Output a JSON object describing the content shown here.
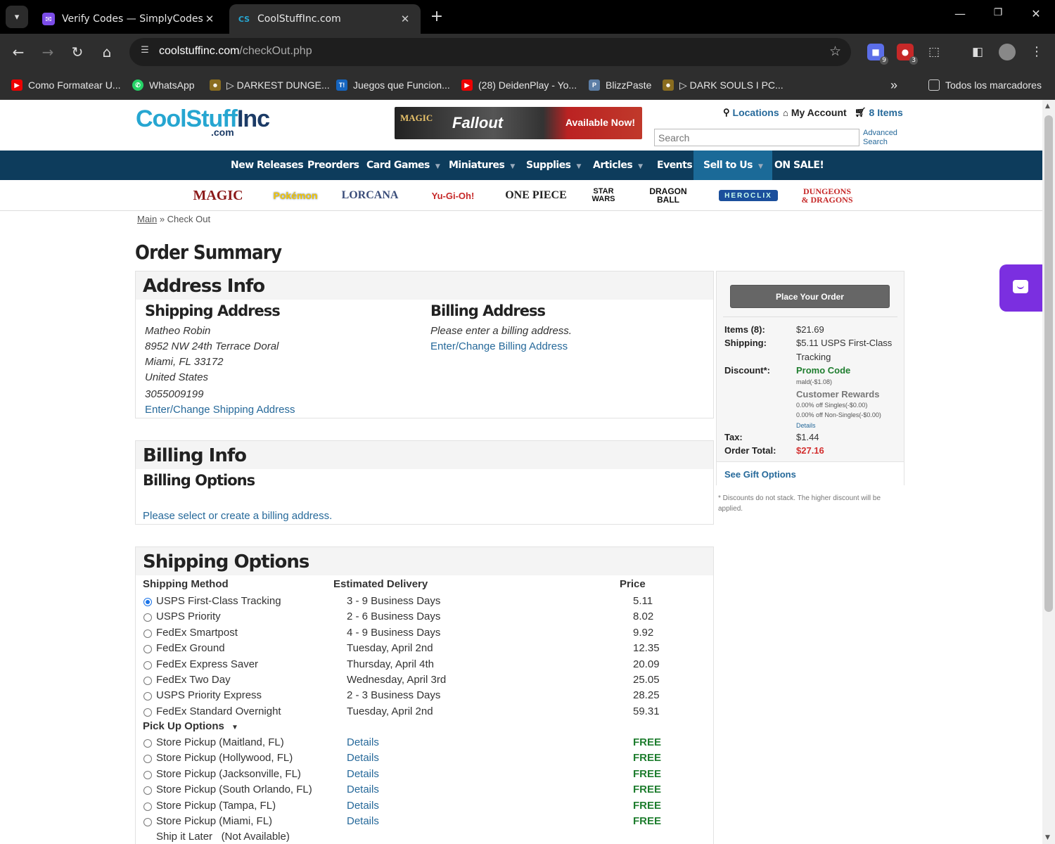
{
  "browser": {
    "tabs": [
      {
        "title": "Verify Codes — SimplyCodes",
        "active": false
      },
      {
        "title": "CoolStuffInc.com",
        "active": true
      }
    ],
    "url_host": "coolstuffinc.com",
    "url_path": "/checkOut.php",
    "extension_badges": [
      "9",
      "3"
    ],
    "bookmarks": [
      "Como Formatear U...",
      "WhatsApp",
      "▷ DARKEST DUNGE...",
      "Juegos que Funcion...",
      "(28) DeidenPlay - Yo...",
      "BlizzPaste",
      "▷ DARK SOULS I PC..."
    ],
    "bookmarks_overflow": "»",
    "all_bookmarks": "Todos los marcadores"
  },
  "site": {
    "logo_main": "CoolStuff",
    "logo_inc": "Inc",
    "logo_sub": ".com",
    "banner": {
      "magic": "MAGIC",
      "fallout": "Fallout",
      "cta": "Available Now!"
    },
    "top_links": {
      "locations": "Locations",
      "account": "My Account",
      "cart": "8 Items"
    },
    "search_placeholder": "Search",
    "advanced_search": [
      "Advanced",
      "Search"
    ],
    "nav": [
      "New Releases",
      "Preorders",
      "Card Games",
      "Miniatures",
      "Supplies",
      "Articles",
      "Events",
      "Sell to Us",
      "ON SALE!"
    ],
    "brands": [
      "MAGIC",
      "Pokémon",
      "LORCANA",
      "Yu-Gi-Oh!",
      "ONE PIECE",
      "STAR WARS",
      "DRAGON BALL",
      "HEROCLIX",
      "DUNGEONS & DRAGONS"
    ],
    "breadcrumb": {
      "main": "Main",
      "sep": "»",
      "current": "Check Out"
    }
  },
  "checkout": {
    "title": "Order Summary",
    "address": {
      "heading": "Address Info",
      "shipping_heading": "Shipping Address",
      "shipping_lines": [
        "Matheo Robin",
        "8952 NW 24th Terrace Doral",
        "Miami, FL 33172",
        "United States",
        "3055009199"
      ],
      "shipping_link": "Enter/Change Shipping Address",
      "billing_heading": "Billing Address",
      "billing_note": "Please enter a billing address.",
      "billing_link": "Enter/Change Billing Address"
    },
    "billing": {
      "heading": "Billing Info",
      "options_heading": "Billing Options",
      "prompt": "Please select or create a billing address."
    },
    "shipping": {
      "heading": "Shipping Options",
      "col_method": "Shipping Method",
      "col_delivery": "Estimated Delivery",
      "col_price": "Price",
      "methods": [
        {
          "name": "USPS First-Class Tracking",
          "delivery": "3 - 9 Business Days",
          "price": "5.11",
          "selected": true
        },
        {
          "name": "USPS Priority",
          "delivery": "2 - 6 Business Days",
          "price": "8.02",
          "selected": false
        },
        {
          "name": "FedEx Smartpost",
          "delivery": "4 - 9 Business Days",
          "price": "9.92",
          "selected": false
        },
        {
          "name": "FedEx Ground",
          "delivery": "Tuesday, April 2nd",
          "price": "12.35",
          "selected": false
        },
        {
          "name": "FedEx Express Saver",
          "delivery": "Thursday, April 4th",
          "price": "20.09",
          "selected": false
        },
        {
          "name": "FedEx Two Day",
          "delivery": "Wednesday, April 3rd",
          "price": "25.05",
          "selected": false
        },
        {
          "name": "USPS Priority Express",
          "delivery": "2 - 3 Business Days",
          "price": "28.25",
          "selected": false
        },
        {
          "name": "FedEx Standard Overnight",
          "delivery": "Tuesday, April 2nd",
          "price": "59.31",
          "selected": false
        }
      ],
      "pickup_heading": "Pick Up Options",
      "pickups": [
        {
          "name": "Store Pickup (Maitland, FL)",
          "link": "Details",
          "price": "FREE"
        },
        {
          "name": "Store Pickup (Hollywood, FL)",
          "link": "Details",
          "price": "FREE"
        },
        {
          "name": "Store Pickup (Jacksonville, FL)",
          "link": "Details",
          "price": "FREE"
        },
        {
          "name": "Store Pickup (South Orlando, FL)",
          "link": "Details",
          "price": "FREE"
        },
        {
          "name": "Store Pickup (Tampa, FL)",
          "link": "Details",
          "price": "FREE"
        },
        {
          "name": "Store Pickup (Miami, FL)",
          "link": "Details",
          "price": "FREE"
        }
      ],
      "ship_later": "Ship it Later",
      "ship_later_status": "(Not Available)"
    },
    "summary": {
      "place_order": "Place Your Order",
      "items_label": "Items (8):",
      "items_value": "$21.69",
      "shipping_label": "Shipping:",
      "shipping_value": "$5.11 USPS First-Class",
      "shipping_value2": "Tracking",
      "discount_label": "Discount*:",
      "promo_code": "Promo Code",
      "promo_detail": "mald(-$1.08)",
      "rewards": "Customer Rewards",
      "rewards_singles": "0.00% off Singles(-$0.00)",
      "rewards_nonsingles": "0.00% off Non-Singles(-$0.00)",
      "details_link": "Details",
      "tax_label": "Tax:",
      "tax_value": "$1.44",
      "total_label": "Order Total:",
      "total_value": "$27.16",
      "gift_link": "See Gift Options",
      "footnote": "* Discounts do not stack. The higher discount will be applied."
    }
  },
  "colors": {
    "nav_bg": "#0d3c5c",
    "link": "#26699a",
    "total_red": "#d32f2f",
    "free_green": "#1e7d2e",
    "promo_green": "#1e7d2e",
    "chat": "#7b2fe0"
  }
}
